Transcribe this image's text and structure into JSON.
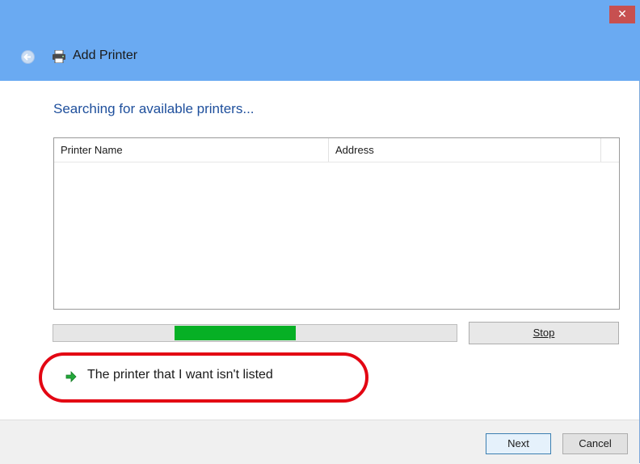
{
  "window": {
    "title": "Add Printer",
    "close_glyph": "✕"
  },
  "main": {
    "heading": "Searching for available printers...",
    "columns": [
      "Printer Name",
      "Address"
    ],
    "rows": [],
    "progress": 0.3,
    "progress_start": 0.3,
    "stop_label": "Stop"
  },
  "link": {
    "text": "The printer that I want isn't listed"
  },
  "footer": {
    "next_label": "Next",
    "cancel_label": "Cancel"
  },
  "colors": {
    "titlebar": "#6aaaf2",
    "heading": "#1e4f9c",
    "progress_fill": "#06b025",
    "highlight_ring": "#e30613"
  },
  "icons": [
    "back-arrow-icon",
    "printer-icon",
    "green-arrow-icon",
    "close-icon"
  ]
}
